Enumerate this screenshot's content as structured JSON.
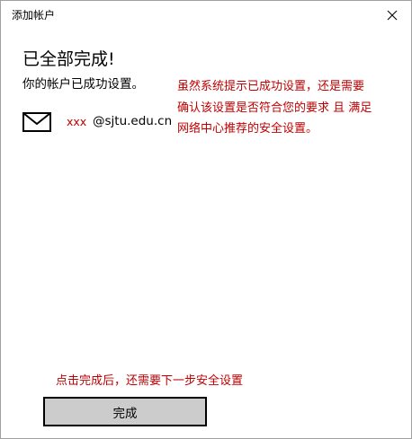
{
  "window": {
    "title": "添加帐户",
    "close_icon": "close-icon"
  },
  "main": {
    "heading": "已全部完成!",
    "subheading": "你的帐户已成功设置。",
    "account": {
      "icon": "mail-icon",
      "user_redacted": "xxx",
      "domain": "@sjtu.edu.cn"
    }
  },
  "annotations": {
    "note_top": [
      "虽然系统提示已成功设置，还是需要",
      "确认该设置是否符合您的要求 且 满足",
      "网络中心推荐的安全设置。"
    ],
    "note_bottom": "点击完成后，还需要下一步安全设置",
    "color": "#c00000"
  },
  "footer": {
    "finish_label": "完成"
  }
}
